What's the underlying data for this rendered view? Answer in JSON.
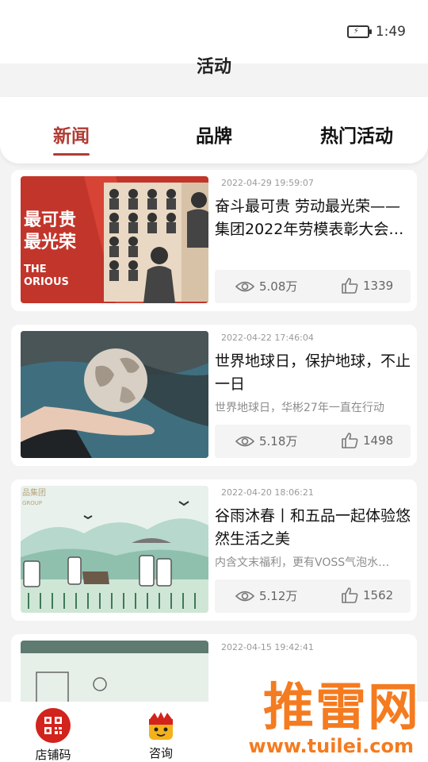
{
  "status": {
    "time": "1:49"
  },
  "header": {
    "title": "活动"
  },
  "tabs": [
    {
      "label": "新闻",
      "active": true
    },
    {
      "label": "品牌",
      "active": false
    },
    {
      "label": "热门活动",
      "active": false
    }
  ],
  "articles": [
    {
      "date": "2022-04-29 19:59:07",
      "title": "奋斗最可贵  劳动最光荣——集团2022年劳模表彰大会…",
      "summary": "",
      "views": "5.08万",
      "likes": "1339",
      "thumb_text": [
        "最可贵",
        "最光荣",
        "THE",
        "ORIOUS"
      ]
    },
    {
      "date": "2022-04-22 17:46:04",
      "title": "世界地球日，保护地球，不止一日",
      "summary": "世界地球日，华彬27年一直在行动",
      "views": "5.18万",
      "likes": "1498"
    },
    {
      "date": "2022-04-20 18:06:21",
      "title": "谷雨沐春丨和五品一起体验悠然生活之美",
      "summary": "内含文末福利，更有VOSS气泡水…",
      "views": "5.12万",
      "likes": "1562",
      "thumb_text": [
        "品集团",
        "GROUP"
      ]
    },
    {
      "date": "2022-04-15 19:42:41",
      "title": "",
      "summary": "",
      "views": "",
      "likes": ""
    }
  ],
  "bottom_nav": [
    {
      "label": "店铺码",
      "icon": "qr-code-icon"
    },
    {
      "label": "咨询",
      "icon": "mascot-icon"
    }
  ],
  "watermark": {
    "brand": "推雷网",
    "url": "www.tuilei.com"
  },
  "colors": {
    "accent": "#b03b33",
    "qr_red": "#d2231c",
    "watermark": "#f47b20"
  }
}
